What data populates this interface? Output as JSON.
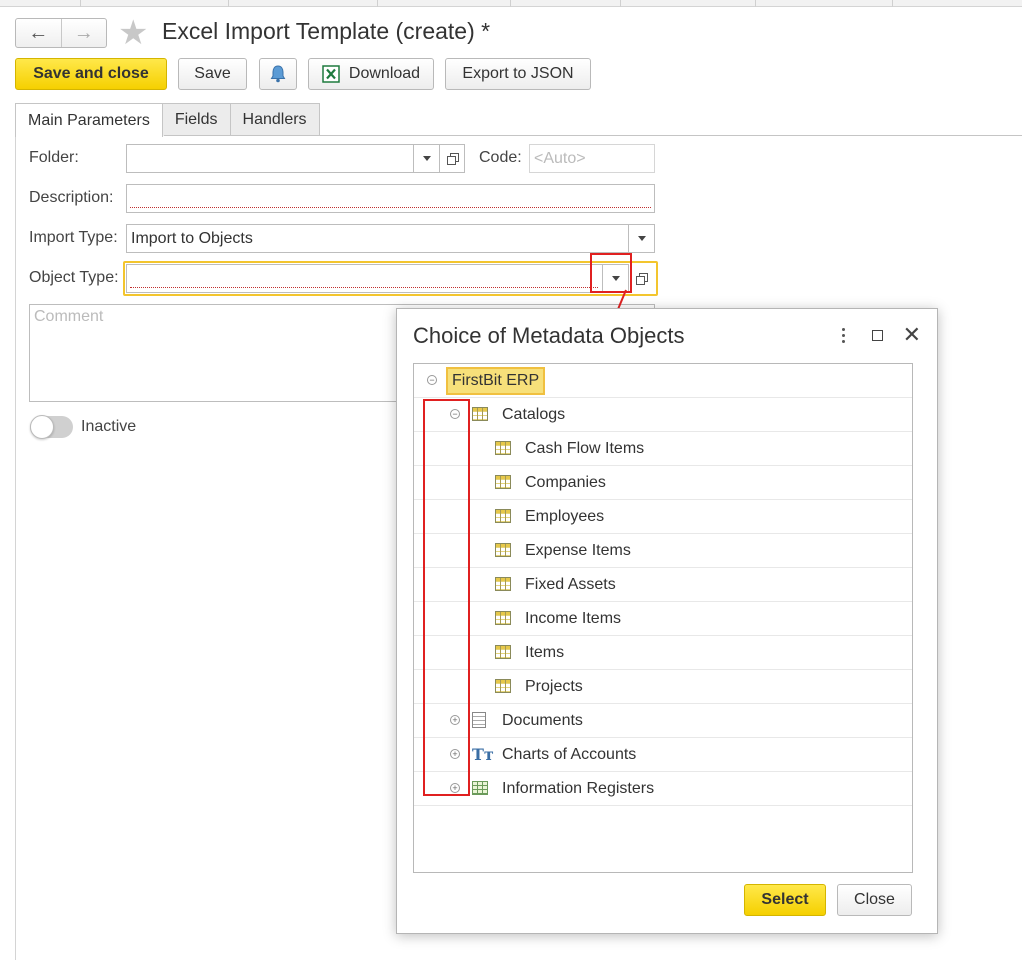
{
  "window": {
    "title": "Excel Import Template (create) *"
  },
  "toolbar": {
    "back_icon": "arrow-left-icon",
    "forward_icon": "arrow-right-icon",
    "save_close_label": "Save and close",
    "save_label": "Save",
    "bell_icon": "bell-icon",
    "download_label": "Download",
    "export_label": "Export to JSON"
  },
  "tabs": [
    {
      "label": "Main Parameters"
    },
    {
      "label": "Fields"
    },
    {
      "label": "Handlers"
    }
  ],
  "form": {
    "folder_label": "Folder:",
    "folder_value": "",
    "code_label": "Code:",
    "code_placeholder": "<Auto>",
    "description_label": "Description:",
    "description_value": "",
    "import_type_label": "Import Type:",
    "import_type_value": "Import to Objects",
    "object_type_label": "Object Type:",
    "object_type_value": "",
    "comment_placeholder": "Comment",
    "inactive_label": "Inactive"
  },
  "dialog": {
    "title": "Choice of Metadata Objects",
    "root": "FirstBit ERP",
    "catalogs_label": "Catalogs",
    "catalog_items": [
      "Cash Flow Items",
      "Companies",
      "Employees",
      "Expense Items",
      "Fixed Assets",
      "Income Items",
      "Items",
      "Projects"
    ],
    "groups": [
      {
        "label": "Documents",
        "icon": "document-icon"
      },
      {
        "label": "Charts of Accounts",
        "icon": "charts-of-accounts-icon"
      },
      {
        "label": "Information Registers",
        "icon": "register-icon"
      }
    ],
    "select_label": "Select",
    "close_label": "Close"
  },
  "colors": {
    "accent_yellow": "#f5d000",
    "highlight_red": "#e02020"
  }
}
